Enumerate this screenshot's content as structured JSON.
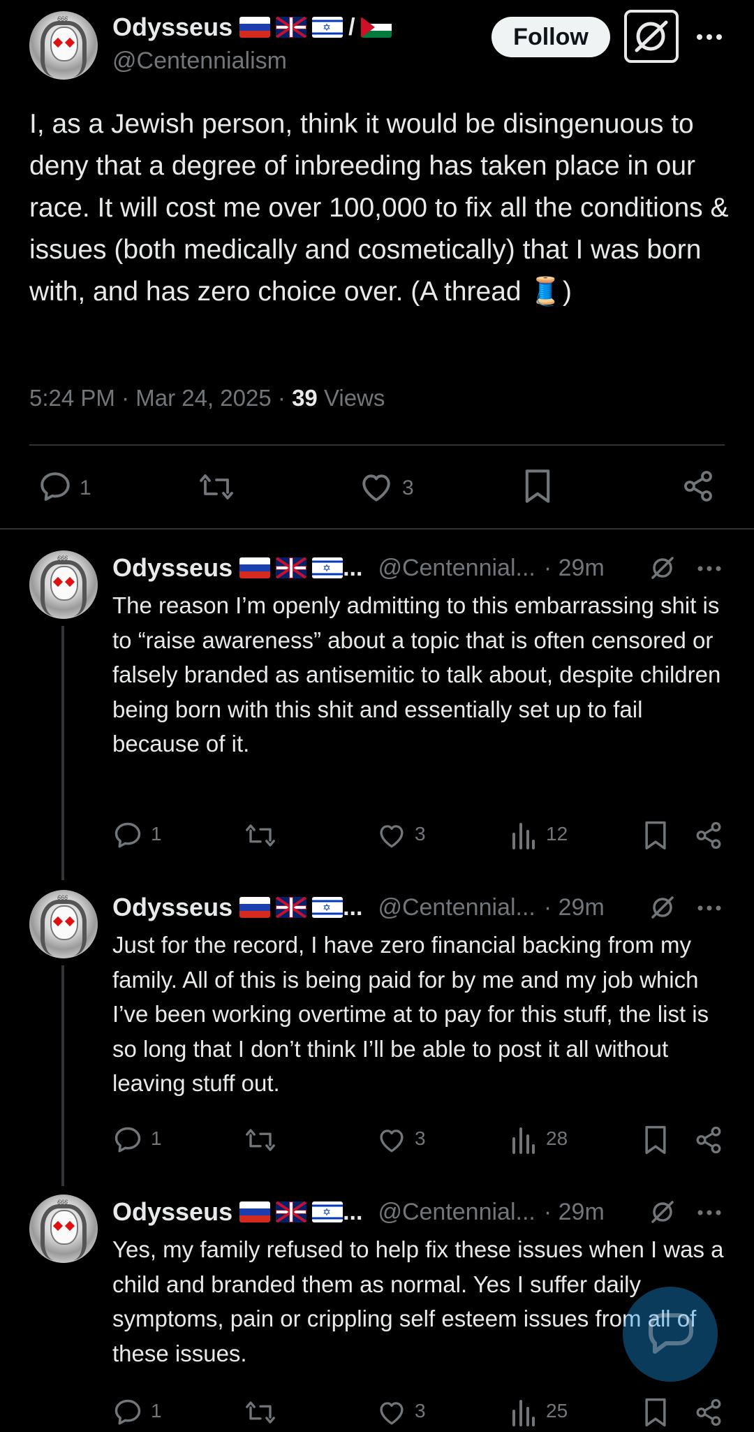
{
  "main": {
    "author": {
      "name": "Odysseus",
      "handle": "@Centennialism",
      "flag_separator": "/"
    },
    "follow_label": "Follow",
    "text": "I, as a Jewish person, think it would be disingenuous to deny that a degree of inbreeding has taken place in our race. It will cost me over 100,000 to fix all the conditions & issues (both medically and cosmetically) that I was born with, and has zero choice over. (A thread 🧵)",
    "time": "5:24 PM",
    "date": "Mar 24, 2025",
    "dot": "·",
    "views_count": "39",
    "views_label": "Views",
    "reply_count": "1",
    "like_count": "3"
  },
  "replies": [
    {
      "name": "Odysseus",
      "ellipsis": "...",
      "handle": "@Centennial...",
      "time": "· 29m",
      "text": "The reason I’m openly admitting to this embarrassing shit is to “raise awareness” about a topic that is often censored or falsely branded as antisemitic to talk about, despite children being born with this shit and essentially set up to fail because of it.",
      "reply_count": "1",
      "like_count": "3",
      "views_count": "12"
    },
    {
      "name": "Odysseus",
      "ellipsis": "...",
      "handle": "@Centennial...",
      "time": "· 29m",
      "text": "Just for the record, I have zero financial backing from my family. All of this is being paid for by me and my job which I’ve been working overtime at to pay for this stuff, the list is so long that I don’t think I’ll be able to post it all without leaving stuff out.",
      "reply_count": "1",
      "like_count": "3",
      "views_count": "28"
    },
    {
      "name": "Odysseus",
      "ellipsis": "...",
      "handle": "@Centennial...",
      "time": "· 29m",
      "text": "Yes, my family refused to help fix these issues when I was a child and branded them as normal. Yes I suffer daily symptoms, pain or crippling self esteem issues from all of these issues.",
      "reply_count": "1",
      "like_count": "3",
      "views_count": "25"
    }
  ],
  "avatar_tag": "666",
  "colors": {
    "background": "#000000",
    "text": "#e7e9ea",
    "muted": "#71767b",
    "divider": "#2f3336",
    "fab": "#1d9bf0"
  },
  "icons": [
    "reply-icon",
    "repost-icon",
    "like-icon",
    "bookmark-icon",
    "share-icon",
    "views-icon",
    "grok-icon",
    "more-icon",
    "compose-icon"
  ]
}
